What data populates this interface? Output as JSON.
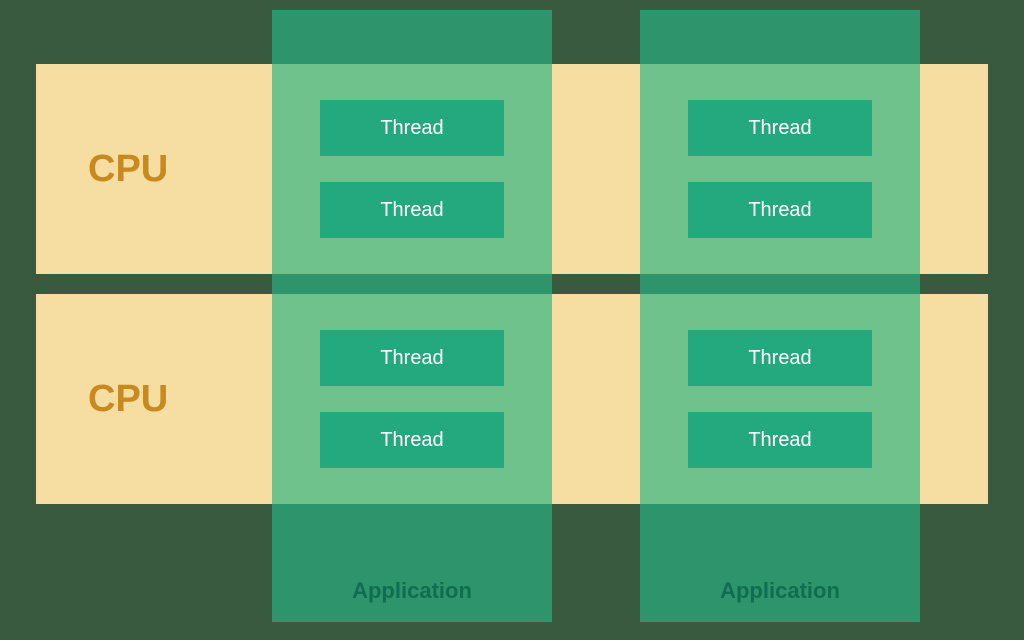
{
  "cpus": [
    {
      "label": "CPU"
    },
    {
      "label": "CPU"
    }
  ],
  "applications": [
    {
      "footer": "Application",
      "groups": [
        {
          "threads": [
            "Thread",
            "Thread"
          ]
        },
        {
          "threads": [
            "Thread",
            "Thread"
          ]
        }
      ]
    },
    {
      "footer": "Application",
      "groups": [
        {
          "threads": [
            "Thread",
            "Thread"
          ]
        },
        {
          "threads": [
            "Thread",
            "Thread"
          ]
        }
      ]
    }
  ],
  "colors": {
    "background": "#3a5a40",
    "cpu_row": "#f6dda1",
    "cpu_text": "#c88a1f",
    "app_overlay": "rgba(40,180,130,0.65)",
    "thread_bg": "#24a87d",
    "thread_text": "#ffffff",
    "app_footer_text": "#0f6e50"
  }
}
